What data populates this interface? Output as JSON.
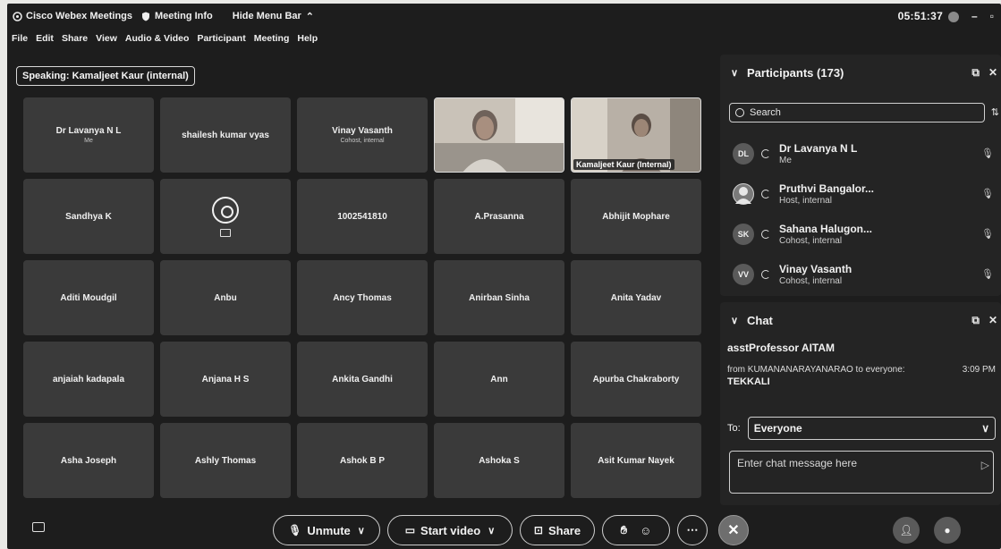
{
  "titlebar": {
    "app_name": "Cisco Webex Meetings",
    "meeting_info": "Meeting Info",
    "hide_menu": "Hide Menu Bar",
    "clock": "05:51:37"
  },
  "menu": [
    "File",
    "Edit",
    "Share",
    "View",
    "Audio & Video",
    "Participant",
    "Meeting",
    "Help"
  ],
  "speaking": "Speaking: Kamaljeet Kaur (internal)",
  "tiles": [
    {
      "name": "Dr Lavanya N L",
      "sub": "Me"
    },
    {
      "name": "shailesh kumar vyas",
      "sub": ""
    },
    {
      "name": "Vinay Vasanth",
      "sub": "Cohost, internal"
    },
    {
      "name": "",
      "sub": "",
      "video": true
    },
    {
      "name": "Kamaljeet Kaur (Internal)",
      "sub": "",
      "video": true
    },
    {
      "name": "Sandhya K",
      "sub": ""
    },
    {
      "name": "",
      "sub": "",
      "obs": true
    },
    {
      "name": "1002541810",
      "sub": ""
    },
    {
      "name": "A.Prasanna",
      "sub": ""
    },
    {
      "name": "Abhijit Mophare",
      "sub": ""
    },
    {
      "name": "Aditi Moudgil",
      "sub": ""
    },
    {
      "name": "Anbu",
      "sub": ""
    },
    {
      "name": "Ancy Thomas",
      "sub": ""
    },
    {
      "name": "Anirban Sinha",
      "sub": ""
    },
    {
      "name": "Anita Yadav",
      "sub": ""
    },
    {
      "name": "anjaiah kadapala",
      "sub": ""
    },
    {
      "name": "Anjana H S",
      "sub": ""
    },
    {
      "name": "Ankita Gandhi",
      "sub": ""
    },
    {
      "name": "Ann",
      "sub": ""
    },
    {
      "name": "Apurba Chakraborty",
      "sub": ""
    },
    {
      "name": "Asha Joseph",
      "sub": ""
    },
    {
      "name": "Ashly Thomas",
      "sub": ""
    },
    {
      "name": "Ashok B P",
      "sub": ""
    },
    {
      "name": "Ashoka S",
      "sub": ""
    },
    {
      "name": "Asit Kumar Nayek",
      "sub": ""
    }
  ],
  "participants": {
    "title": "Participants (173)",
    "search_placeholder": "Search",
    "list": [
      {
        "initials": "DL",
        "name": "Dr Lavanya N L",
        "role": "Me"
      },
      {
        "initials": "",
        "name": "Pruthvi Bangalor...",
        "role": "Host, internal"
      },
      {
        "initials": "SK",
        "name": "Sahana Halugon...",
        "role": "Cohost, internal"
      },
      {
        "initials": "VV",
        "name": "Vinay Vasanth",
        "role": "Cohost, internal"
      }
    ]
  },
  "chat": {
    "title": "Chat",
    "line1": "asstProfessor AITAM",
    "meta_from": "from KUMANANARAYANARAO to everyone:",
    "meta_time": "3:09 PM",
    "message": "TEKKALI",
    "to_label": "To:",
    "to_value": "Everyone",
    "input_placeholder": "Enter chat message here"
  },
  "toolbar": {
    "unmute": "Unmute",
    "start_video": "Start video",
    "share": "Share"
  }
}
